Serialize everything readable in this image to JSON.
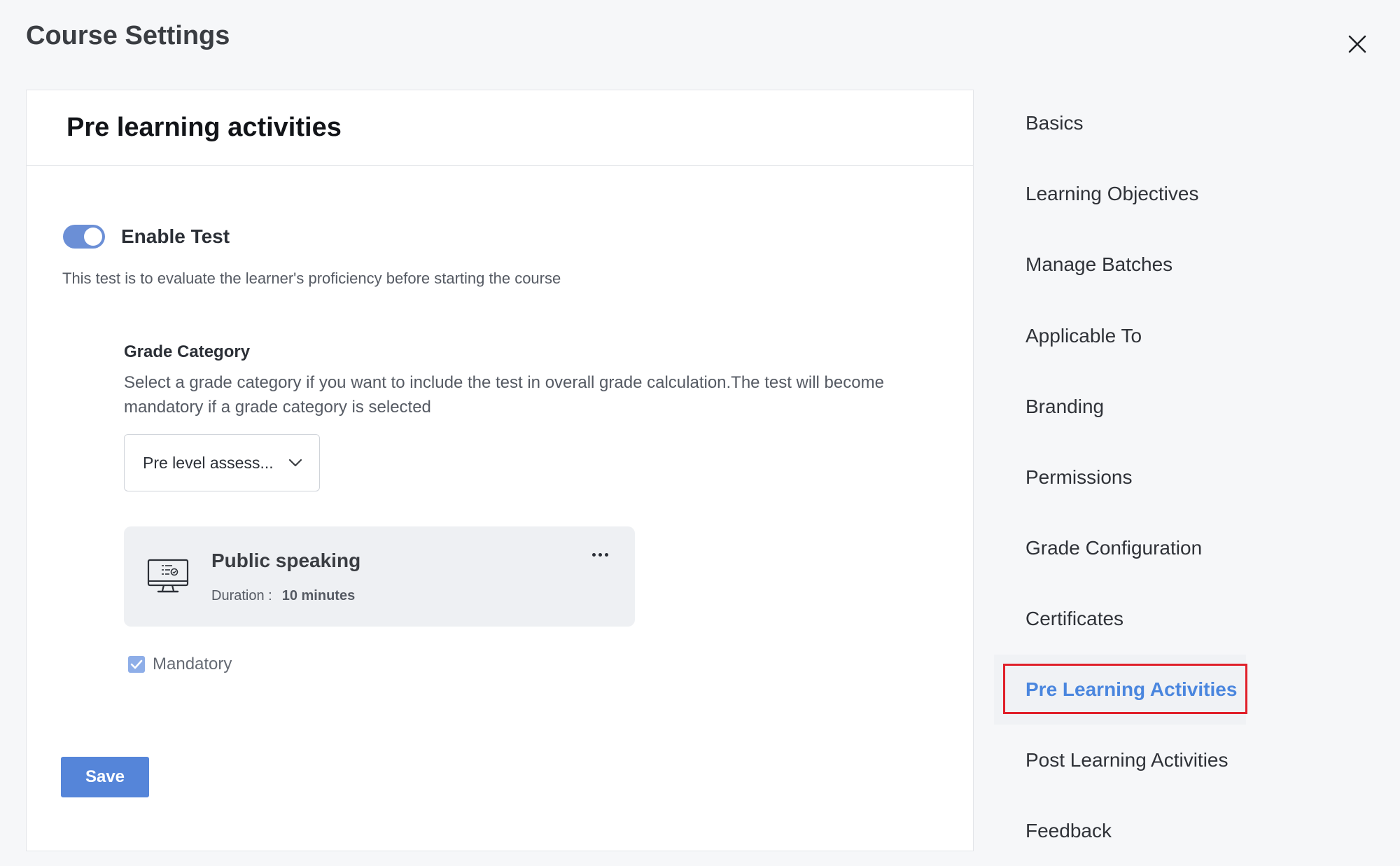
{
  "page": {
    "title": "Course Settings"
  },
  "panel": {
    "title": "Pre learning activities",
    "enable_test": {
      "label": "Enable Test",
      "enabled": true
    },
    "helper_text": "This test is to evaluate the learner's proficiency before starting the course",
    "grade_category": {
      "title": "Grade Category",
      "description": "Select a grade category if you want to include the test in overall grade calculation.The test will become mandatory if a grade category is selected",
      "selected": "Pre level assess..."
    },
    "test_card": {
      "title": "Public speaking",
      "duration_label": "Duration :",
      "duration_value": "10 minutes"
    },
    "mandatory": {
      "label": "Mandatory",
      "checked": true
    },
    "save_label": "Save"
  },
  "nav": {
    "items": [
      {
        "label": "Basics"
      },
      {
        "label": "Learning Objectives"
      },
      {
        "label": "Manage Batches"
      },
      {
        "label": "Applicable To"
      },
      {
        "label": "Branding"
      },
      {
        "label": "Permissions"
      },
      {
        "label": "Grade Configuration"
      },
      {
        "label": "Certificates"
      },
      {
        "label": "Pre Learning Activities",
        "active": true
      },
      {
        "label": "Post Learning Activities"
      },
      {
        "label": "Feedback"
      }
    ]
  },
  "colors": {
    "accent": "#5585d9",
    "active_nav_text": "#4a86de",
    "highlight_border": "#e0202a",
    "toggle_on": "#6b8fd6"
  }
}
